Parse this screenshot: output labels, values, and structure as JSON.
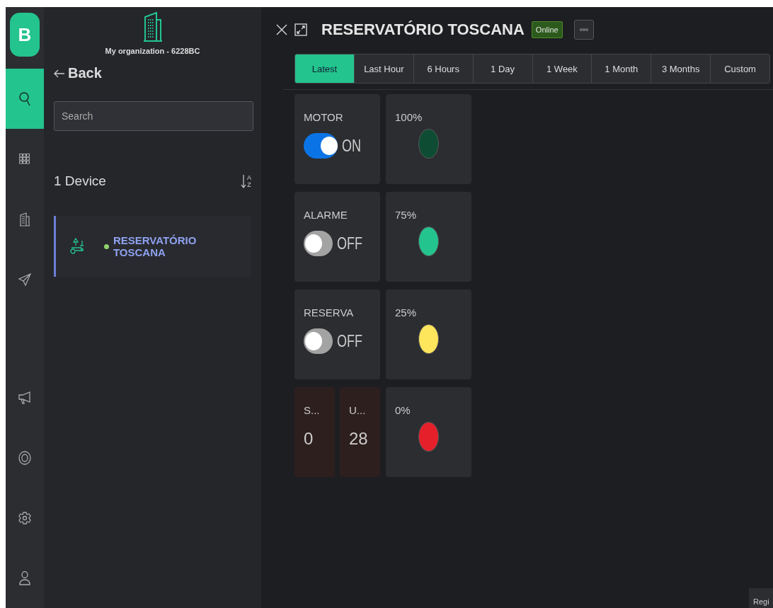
{
  "rail": {
    "logo": "B",
    "items": [
      {
        "kind": "search",
        "selected": true
      },
      {
        "kind": "grid",
        "selected": false
      },
      {
        "kind": "building",
        "selected": false
      },
      {
        "kind": "send",
        "selected": false
      },
      {
        "kind": "megaphone",
        "selected": false
      },
      {
        "kind": "lifebuoy",
        "selected": false
      },
      {
        "kind": "settings",
        "selected": false
      },
      {
        "kind": "user",
        "selected": false
      }
    ]
  },
  "panel": {
    "organization": "My organization - 6228BC",
    "back": "Back",
    "search": {
      "placeholder": "Search"
    },
    "count": "1 Device",
    "sort": {
      "top": "A",
      "bottom": "Z"
    },
    "devices": [
      {
        "name": "RESERVATÓRIO TOSCANA",
        "online": true,
        "selected": true
      }
    ]
  },
  "device": {
    "title": "RESERVATÓRIO TOSCANA",
    "status": "Online"
  },
  "tabs": [
    {
      "label": "Latest",
      "selected": true
    },
    {
      "label": "Last Hour",
      "selected": false
    },
    {
      "label": "6 Hours",
      "selected": false
    },
    {
      "label": "1 Day",
      "selected": false
    },
    {
      "label": "1 Week",
      "selected": false
    },
    {
      "label": "1 Month",
      "selected": false
    },
    {
      "label": "3 Months",
      "selected": false
    },
    {
      "label": "Custom",
      "selected": false
    }
  ],
  "widget_rows": [
    [
      {
        "kind": "switch",
        "label": "MOTOR",
        "on": true,
        "state": "ON"
      },
      {
        "kind": "led",
        "label": "100%",
        "color": "#0e4d34"
      }
    ],
    [
      {
        "kind": "switch",
        "label": "ALARME",
        "on": false,
        "state": "OFF"
      },
      {
        "kind": "led",
        "label": "75%",
        "color": "#23c48e"
      }
    ],
    [
      {
        "kind": "switch",
        "label": "RESERVA",
        "on": false,
        "state": "OFF"
      },
      {
        "kind": "led",
        "label": "25%",
        "color": "#fde55c"
      }
    ],
    [
      {
        "kind": "value",
        "label": "S...",
        "value": "0"
      },
      {
        "kind": "value",
        "label": "U...",
        "value": "28"
      },
      {
        "kind": "led",
        "label": "0%",
        "color": "#e5202b"
      }
    ]
  ],
  "corner_button": "Regi"
}
